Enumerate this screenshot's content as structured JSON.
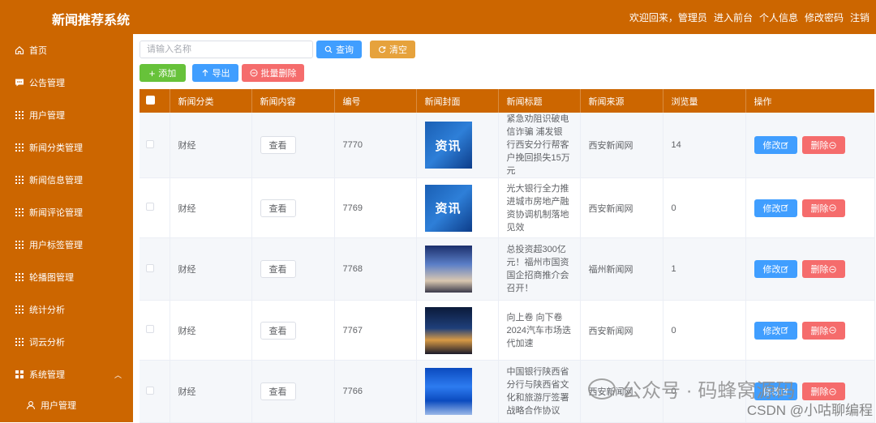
{
  "header": {
    "title": "新闻推荐系统",
    "welcome": "欢迎回来，管理员",
    "links": [
      "进入前台",
      "个人信息",
      "修改密码",
      "注销"
    ]
  },
  "sidebar": {
    "items": [
      {
        "label": "首页",
        "icon": "home-icon"
      },
      {
        "label": "公告管理",
        "icon": "chat-icon"
      },
      {
        "label": "用户管理",
        "icon": "grid-icon"
      },
      {
        "label": "新闻分类管理",
        "icon": "grid-icon"
      },
      {
        "label": "新闻信息管理",
        "icon": "grid-icon"
      },
      {
        "label": "新闻评论管理",
        "icon": "grid-icon"
      },
      {
        "label": "用户标签管理",
        "icon": "grid-icon"
      },
      {
        "label": "轮播图管理",
        "icon": "grid-icon"
      },
      {
        "label": "统计分析",
        "icon": "grid-icon"
      },
      {
        "label": "词云分析",
        "icon": "grid-icon"
      },
      {
        "label": "系统管理",
        "icon": "apps-icon"
      },
      {
        "label": "用户管理",
        "icon": "user-icon"
      }
    ]
  },
  "toolbar": {
    "search_placeholder": "请输入名称",
    "query_label": "查询",
    "clear_label": "清空",
    "add_label": "添加",
    "export_label": "导出",
    "batch_delete_label": "批量删除"
  },
  "table": {
    "columns": [
      "新闻分类",
      "新闻内容",
      "编号",
      "新闻封面",
      "新闻标题",
      "新闻来源",
      "浏览量",
      "操作"
    ],
    "view_label": "查看",
    "edit_label": "修改",
    "delete_label": "删除",
    "rows": [
      {
        "category": "财经",
        "id": "7770",
        "cover_text": "资讯",
        "title": "紧急劝阻识破电信诈骗 浦发银行西安分行帮客户挽回损失15万元",
        "source": "西安新闻网",
        "views": "14"
      },
      {
        "category": "财经",
        "id": "7769",
        "cover_text": "资讯",
        "title": "光大银行全力推进城市房地产融资协调机制落地见效",
        "source": "西安新闻网",
        "views": "0"
      },
      {
        "category": "财经",
        "id": "7768",
        "cover_text": "",
        "title": "总投资超300亿元！福州市国资国企招商推介会召开！",
        "source": "福州新闻网",
        "views": "1"
      },
      {
        "category": "财经",
        "id": "7767",
        "cover_text": "",
        "title": "向上卷 向下卷 2024汽车市场迭代加速",
        "source": "西安新闻网",
        "views": "0"
      },
      {
        "category": "财经",
        "id": "7766",
        "cover_text": "",
        "title": "中国银行陕西省分行与陕西省文化和旅游厅签署战略合作协议",
        "source": "西安新闻网",
        "views": "0"
      }
    ]
  },
  "watermark": {
    "main": "公众号 · 码蜂窝源码",
    "sub": "CSDN @小咕聊编程"
  },
  "colors": {
    "brand": "#cc6600",
    "primary": "#409eff",
    "warning": "#e6a23c",
    "success": "#67c23a",
    "danger": "#f56c6c"
  }
}
